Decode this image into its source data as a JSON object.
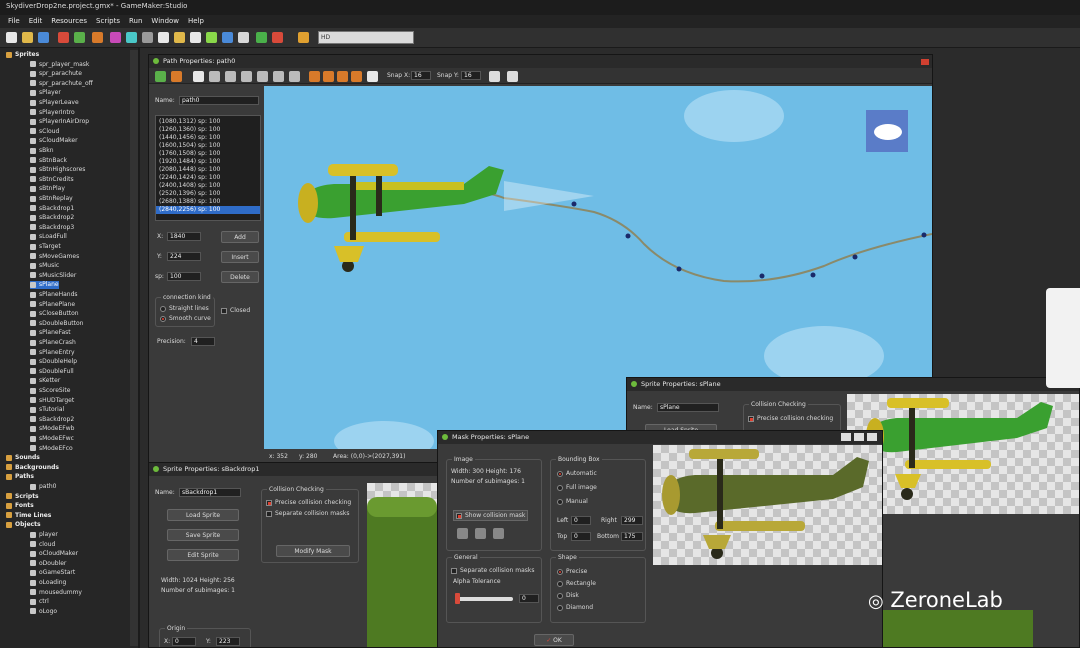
{
  "app": {
    "title": "SkydiverDrop2ne.project.gmx* - GameMaker:Studio",
    "menu": [
      "File",
      "Edit",
      "Resources",
      "Scripts",
      "Run",
      "Window",
      "Help"
    ]
  },
  "toolbar": {
    "search_value": "HD"
  },
  "tree": {
    "items": [
      {
        "label": "Sprites",
        "kind": "folder",
        "icon": "folder-icon"
      },
      {
        "label": "spr_player_mask",
        "kind": "item"
      },
      {
        "label": "spr_parachute",
        "kind": "item"
      },
      {
        "label": "spr_parachute_off",
        "kind": "item"
      },
      {
        "label": "sPlayer",
        "kind": "item"
      },
      {
        "label": "sPlayerLeave",
        "kind": "item"
      },
      {
        "label": "sPlayerIntro",
        "kind": "item"
      },
      {
        "label": "sPlayerInAirDrop",
        "kind": "item"
      },
      {
        "label": "sCloud",
        "kind": "item"
      },
      {
        "label": "sCloudMaker",
        "kind": "item"
      },
      {
        "label": "sBkn",
        "kind": "item"
      },
      {
        "label": "sBtnBack",
        "kind": "item"
      },
      {
        "label": "sBtnHighscores",
        "kind": "item"
      },
      {
        "label": "sBtnCredits",
        "kind": "item"
      },
      {
        "label": "sBtnPlay",
        "kind": "item"
      },
      {
        "label": "sBtnReplay",
        "kind": "item"
      },
      {
        "label": "sBackdrop1",
        "kind": "item"
      },
      {
        "label": "sBackdrop2",
        "kind": "item"
      },
      {
        "label": "sBackdrop3",
        "kind": "item"
      },
      {
        "label": "sLoadFull",
        "kind": "item"
      },
      {
        "label": "sTarget",
        "kind": "item"
      },
      {
        "label": "sMoveGames",
        "kind": "item"
      },
      {
        "label": "sMusic",
        "kind": "item"
      },
      {
        "label": "sMusicSlider",
        "kind": "item"
      },
      {
        "label": "sPlane",
        "kind": "item",
        "selected": true
      },
      {
        "label": "sPlaneHands",
        "kind": "item"
      },
      {
        "label": "sPlanePlane",
        "kind": "item"
      },
      {
        "label": "sCloseButton",
        "kind": "item"
      },
      {
        "label": "sDoubleButton",
        "kind": "item"
      },
      {
        "label": "sPlaneFast",
        "kind": "item"
      },
      {
        "label": "sPlaneCrash",
        "kind": "item"
      },
      {
        "label": "sPlaneEntry",
        "kind": "item"
      },
      {
        "label": "sDoubleHelp",
        "kind": "item"
      },
      {
        "label": "sDoubleFull",
        "kind": "item"
      },
      {
        "label": "sKetter",
        "kind": "item"
      },
      {
        "label": "sScoreSite",
        "kind": "item"
      },
      {
        "label": "sHUDTarget",
        "kind": "item"
      },
      {
        "label": "sTutorial",
        "kind": "item"
      },
      {
        "label": "sBackdrop2",
        "kind": "item"
      },
      {
        "label": "sModeEFwb",
        "kind": "item"
      },
      {
        "label": "sModeEFwc",
        "kind": "item"
      },
      {
        "label": "sModeEFco",
        "kind": "item"
      },
      {
        "label": "Sounds",
        "kind": "folder"
      },
      {
        "label": "Backgrounds",
        "kind": "folder"
      },
      {
        "label": "Paths",
        "kind": "folder"
      },
      {
        "label": "path0",
        "kind": "item"
      },
      {
        "label": "Scripts",
        "kind": "folder"
      },
      {
        "label": "Fonts",
        "kind": "folder"
      },
      {
        "label": "Time Lines",
        "kind": "folder"
      },
      {
        "label": "Objects",
        "kind": "folder"
      },
      {
        "label": "player",
        "kind": "item"
      },
      {
        "label": "cloud",
        "kind": "item"
      },
      {
        "label": "oCloudMaker",
        "kind": "item"
      },
      {
        "label": "oDoubler",
        "kind": "item"
      },
      {
        "label": "oGameStart",
        "kind": "item"
      },
      {
        "label": "oLoading",
        "kind": "item"
      },
      {
        "label": "mousedummy",
        "kind": "item"
      },
      {
        "label": "ctrl",
        "kind": "item"
      },
      {
        "label": "oLogo",
        "kind": "item"
      }
    ]
  },
  "path_window": {
    "title": "Path Properties: path0",
    "snap_x_label": "Snap X:",
    "snap_x": "16",
    "snap_y_label": "Snap Y:",
    "snap_y": "16",
    "name_label": "Name:",
    "name": "path0",
    "points": [
      "(1080,1312) sp: 100",
      "(1260,1360) sp: 100",
      "(1440,1456) sp: 100",
      "(1600,1504) sp: 100",
      "(1760,1508) sp: 100",
      "(1920,1484) sp: 100",
      "(2080,1448) sp: 100",
      "(2240,1424) sp: 100",
      "(2400,1408) sp: 100",
      "(2520,1396) sp: 100",
      "(2680,1388) sp: 100",
      "(2840,2256) sp: 100"
    ],
    "x_label": "X:",
    "x": "1840",
    "y_label": "Y:",
    "y": "224",
    "sp_label": "sp:",
    "sp": "100",
    "add_label": "Add",
    "insert_label": "Insert",
    "delete_label": "Delete",
    "connection_title": "connection kind",
    "straight_label": "Straight lines",
    "smooth_label": "Smooth curve",
    "closed_label": "Closed",
    "precision_label": "Precision:",
    "precision": "4",
    "status_x": "x: 352",
    "status_y": "y: 280",
    "status_area": "Area: (0,0)->(2027,391)"
  },
  "sprite_window": {
    "title": "Sprite Properties: sBackdrop1",
    "name_label": "Name:",
    "name": "sBackdrop1",
    "load_label": "Load Sprite",
    "save_label": "Save Sprite",
    "edit_label": "Edit Sprite",
    "size_text": "Width: 1024  Height: 256",
    "subimages_text": "Number of subimages: 1",
    "origin_title": "Origin",
    "ox_label": "X:",
    "ox": "0",
    "oy_label": "Y:",
    "oy": "223",
    "collision_title": "Collision Checking",
    "precise_label": "Precise collision checking",
    "separate_label": "Separate collision masks",
    "modify_mask_label": "Modify Mask"
  },
  "sprite_window_plane": {
    "title": "Sprite Properties: sPlane",
    "name_label": "Name:",
    "name": "sPlane",
    "load_label": "Load Sprite",
    "collision_title": "Collision Checking",
    "precise_label": "Precise collision checking"
  },
  "mask_window": {
    "title": "Mask Properties: sPlane",
    "image_title": "Image",
    "size_text": "Width: 300  Height: 176",
    "subimages_text": "Number of subimages: 1",
    "show_mask_label": "Show collision mask",
    "general_title": "General",
    "separate_label": "Separate collision masks",
    "alpha_label": "Alpha Tolerance",
    "alpha_value": "0",
    "bbox_title": "Bounding Box",
    "automatic_label": "Automatic",
    "full_label": "Full image",
    "manual_label": "Manual",
    "left_label": "Left",
    "left": "0",
    "right_label": "Right",
    "right": "299",
    "top_label": "Top",
    "top": "0",
    "bottom_label": "Bottom",
    "bottom": "175",
    "shape_title": "Shape",
    "precise_label": "Precise",
    "rectangle_label": "Rectangle",
    "disk_label": "Disk",
    "diamond_label": "Diamond",
    "ok_label": "OK"
  },
  "watermark": {
    "text": "ZeroneLab"
  },
  "colors": {
    "sky": "#6fbde6",
    "selection": "#2f6cc8",
    "grass": "#4e7a22"
  }
}
